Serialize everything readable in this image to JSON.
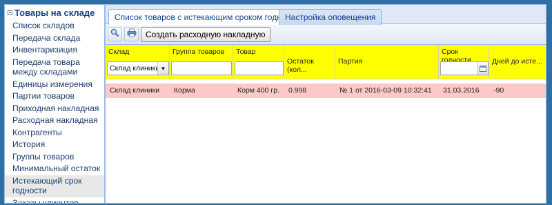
{
  "sidebar": {
    "title": "Товары на складе",
    "items": [
      {
        "label": "Список складов"
      },
      {
        "label": "Передача склада"
      },
      {
        "label": "Инвентаризиция"
      },
      {
        "label": "Передача товара между складами"
      },
      {
        "label": "Единицы измерения"
      },
      {
        "label": "Партии товаров"
      },
      {
        "label": "Приходная накладная"
      },
      {
        "label": "Расходная накладная"
      },
      {
        "label": "Контрагенты"
      },
      {
        "label": "История"
      },
      {
        "label": "Группы товаров"
      },
      {
        "label": "Минимальный остаток"
      },
      {
        "label": "Истекающий срок годности"
      },
      {
        "label": "Заказы клиентов"
      }
    ]
  },
  "tabs": [
    {
      "label": "Список товаров с истекающим сроком годности"
    },
    {
      "label": "Настройка оповещения"
    }
  ],
  "toolbar": {
    "create_label": "Создать расходную накладную"
  },
  "grid": {
    "columns": [
      {
        "label": "Склад"
      },
      {
        "label": "Группа товаров"
      },
      {
        "label": "Товар"
      },
      {
        "label": "Остаток (кол..."
      },
      {
        "label": "Партия"
      },
      {
        "label": "Срок годности"
      },
      {
        "label": "Дней до исте..."
      }
    ],
    "filters": {
      "warehouse_value": "Склад клиники"
    },
    "rows": [
      {
        "warehouse": "Склад клиники",
        "group": "Корма",
        "product": "Корм 400 гр.",
        "balance": "0.998",
        "batch": "№ 1 от 2016-03-09 10:32:41",
        "expiry": "31.03.2016",
        "days_left": "-90"
      }
    ]
  },
  "colors": {
    "header_bg": "#ffff00",
    "row_bg": "#fcc8c8",
    "accent": "#15428b"
  }
}
